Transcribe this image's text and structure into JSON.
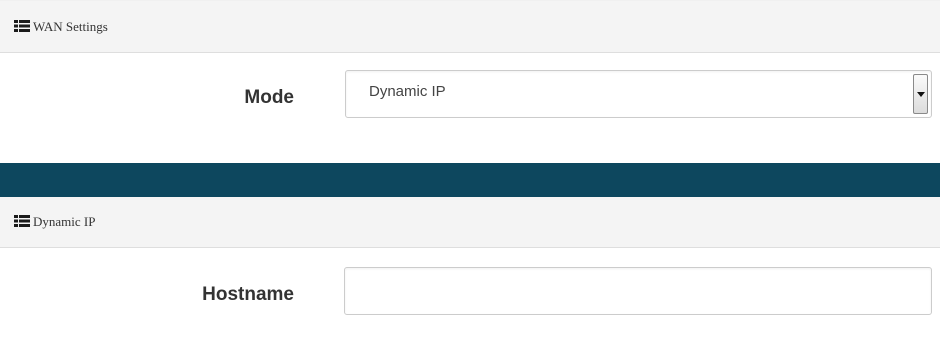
{
  "wan_settings": {
    "title": "WAN Settings",
    "icon": "grid-icon"
  },
  "mode": {
    "label": "Mode",
    "selected": "Dynamic IP"
  },
  "dynamic_ip": {
    "title": "Dynamic IP",
    "icon": "grid-icon"
  },
  "hostname": {
    "label": "Hostname",
    "value": "",
    "placeholder": ""
  },
  "colors": {
    "header_bg": "#f4f4f4",
    "divider_band": "#0d475e",
    "label_text": "#333333"
  }
}
